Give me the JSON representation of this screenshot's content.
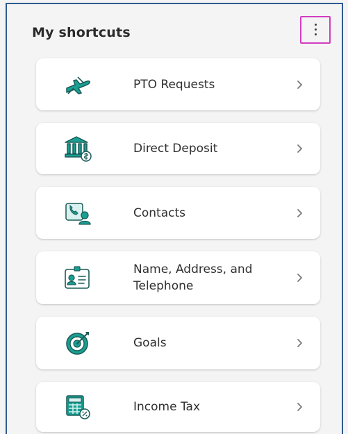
{
  "header": {
    "title": "My shortcuts",
    "more_icon": "vertical-ellipsis-icon"
  },
  "shortcuts": [
    {
      "label": "PTO Requests",
      "icon": "airplane-icon"
    },
    {
      "label": "Direct Deposit",
      "icon": "bank-icon"
    },
    {
      "label": "Contacts",
      "icon": "contacts-icon"
    },
    {
      "label": "Name, Address, and Telephone",
      "icon": "id-card-icon"
    },
    {
      "label": "Goals",
      "icon": "target-icon"
    },
    {
      "label": "Income Tax",
      "icon": "calculator-icon"
    }
  ],
  "colors": {
    "teal": "#0b8c84",
    "dark_teal": "#1a5b57",
    "highlight": "#d23cc1",
    "border": "#2f5b8f"
  }
}
